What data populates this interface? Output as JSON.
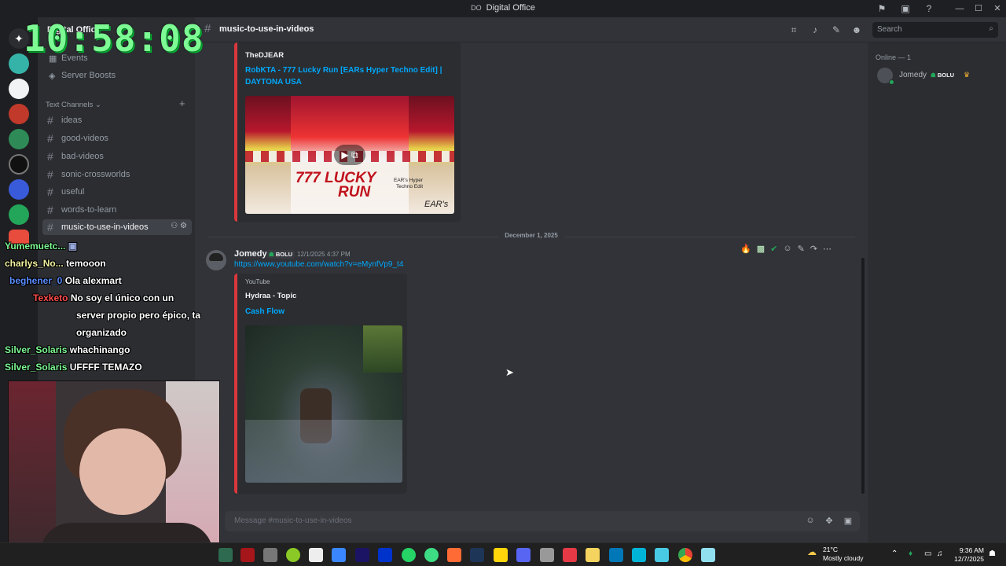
{
  "window": {
    "title": "Digital Office"
  },
  "server": {
    "name": "Digital Office",
    "items": [
      {
        "label": "Events",
        "icon": "calendar-icon"
      },
      {
        "label": "Server Boosts",
        "icon": "boost-icon"
      }
    ]
  },
  "category": {
    "label": "Text Channels"
  },
  "channels": [
    {
      "name": "ideas"
    },
    {
      "name": "good-videos"
    },
    {
      "name": "bad-videos"
    },
    {
      "name": "sonic-crossworlds"
    },
    {
      "name": "useful"
    },
    {
      "name": "words-to-learn"
    },
    {
      "name": "music-to-use-in-videos",
      "active": true
    }
  ],
  "header": {
    "channel": "music-to-use-in-videos"
  },
  "search": {
    "placeholder": "Search"
  },
  "embed1": {
    "author": "TheDJEAR",
    "title_line1": "RobKTA - 777 Lucky Run [EARs Hyper Techno Edit] |",
    "title_line2": "DAYTONA USA",
    "thumb_text_big1": "777 LUCKY",
    "thumb_text_big2": "RUN",
    "thumb_text_ears": "EAR's",
    "thumb_text_hyper": "EAR's Hyper Techno Edit"
  },
  "divider": {
    "date": "December 1, 2025"
  },
  "message": {
    "username": "Jomedy",
    "tag": "BOLU",
    "timestamp": "12/1/2025 4:37 PM",
    "link": "https://www.youtube.com/watch?v=eMynfVp9_t4"
  },
  "embed2": {
    "provider": "YouTube",
    "author": "Hydraa - Topic",
    "title": "Cash Flow"
  },
  "composer": {
    "placeholder": "Message #music-to-use-in-videos"
  },
  "members": {
    "group": "Online — 1",
    "list": [
      {
        "name": "Jomedy",
        "tag": "BOLU"
      }
    ]
  },
  "overlay": {
    "clock": "10:58:08",
    "chat": [
      {
        "user": "Yumemuetc...",
        "color": "#7dfa94",
        "text": ""
      },
      {
        "user": "charlys_No...",
        "color": "#f2f2a0",
        "text": "temooon"
      },
      {
        "user": "beghener_0",
        "color": "#5a8cff",
        "text": "Ola alexmart"
      },
      {
        "user": "Texketo",
        "color": "#ff4d4d",
        "text": "No soy el único con un"
      },
      {
        "user": "",
        "color": "#ffffff",
        "text": "server propio pero épico, ta"
      },
      {
        "user": "",
        "color": "#ffffff",
        "text": "organizado"
      },
      {
        "user": "Silver_Solaris",
        "color": "#7dfa94",
        "text": "whachinango"
      },
      {
        "user": "Silver_Solaris",
        "color": "#7dfa94",
        "text": "UFFFF TEMAZO"
      }
    ]
  },
  "taskbar": {
    "temp": "21°C",
    "weather": "Mostly cloudy",
    "time": "9:36 AM",
    "date": "12/7/2025"
  }
}
